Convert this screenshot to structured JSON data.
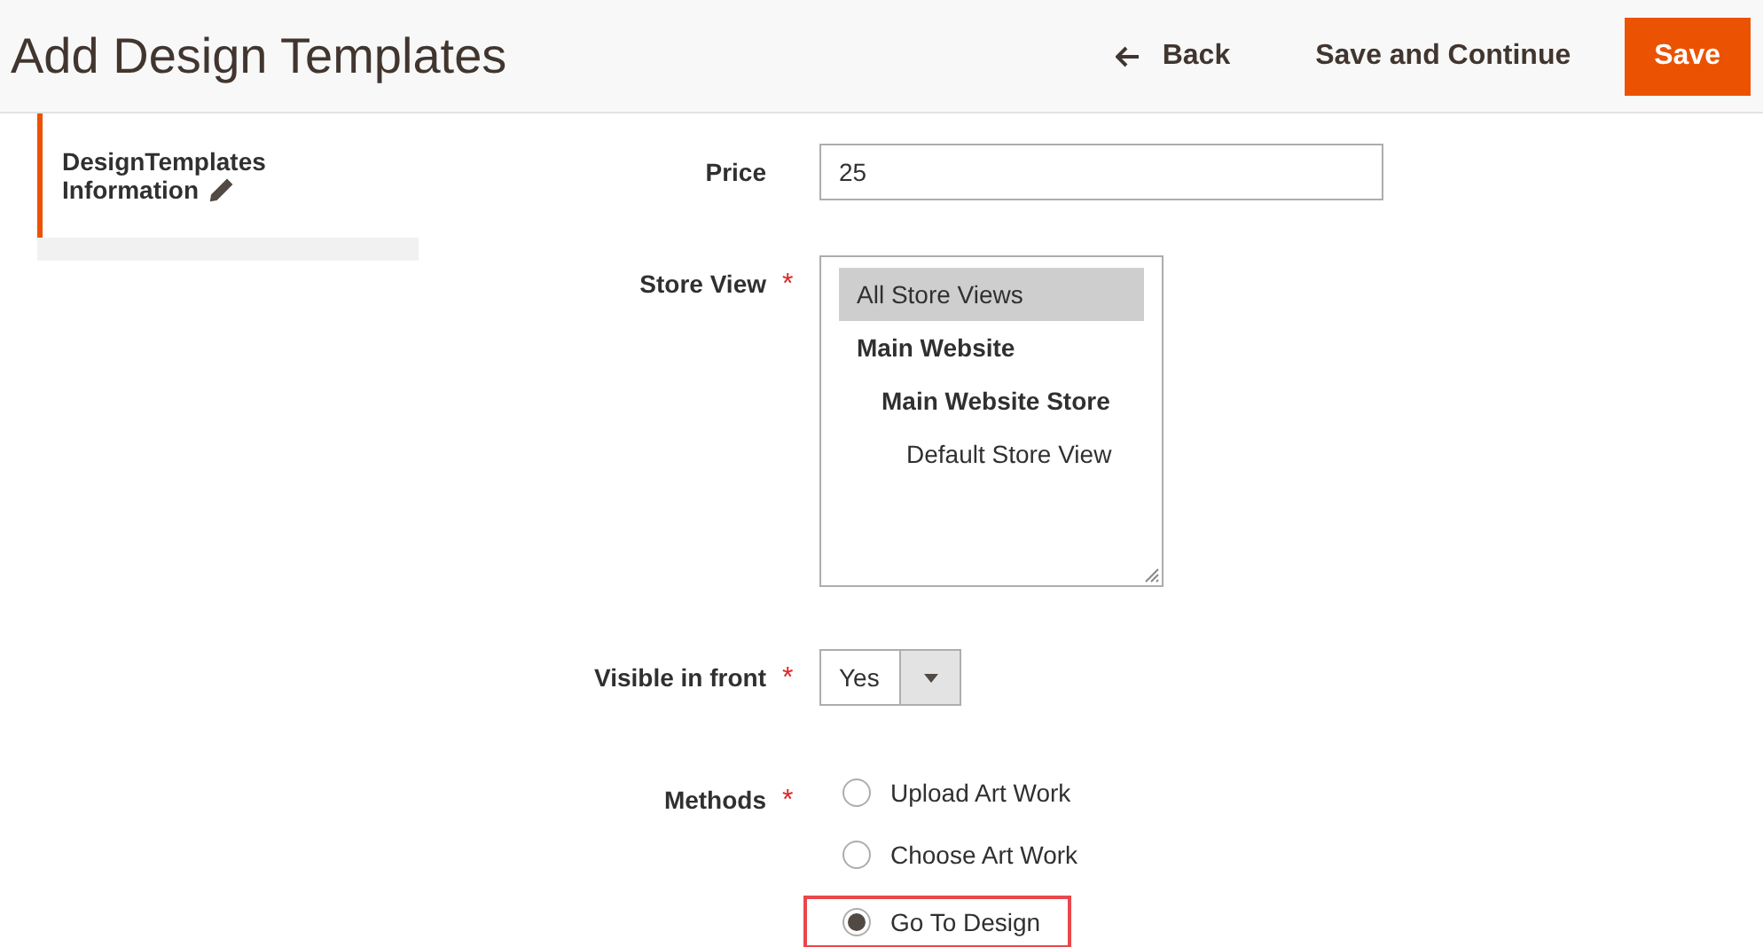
{
  "header": {
    "title": "Add Design Templates",
    "actions": [
      {
        "kind": "back",
        "label": "Back"
      },
      {
        "kind": "secondary",
        "label": "Save and Continue"
      },
      {
        "kind": "primary",
        "label": "Save"
      }
    ]
  },
  "sidebar": {
    "items": [
      {
        "label": "DesignTemplates Information",
        "selected": true,
        "edited": true
      }
    ]
  },
  "form": {
    "fields": [
      {
        "kind": "text",
        "label": "Price",
        "value": "25"
      },
      {
        "kind": "multiselect",
        "label": "Store View",
        "required_mark": "*",
        "options": [
          {
            "label": "All Store Views",
            "selected": true
          },
          {
            "label": "Main Website",
            "selected": false,
            "children": [
              {
                "label": "Main Website Store",
                "selected": false,
                "children": [
                  {
                    "label": "Default Store View",
                    "selected": false
                  }
                ]
              }
            ]
          }
        ]
      },
      {
        "kind": "select",
        "label": "Visible in front",
        "required_mark": "*",
        "value": "Yes"
      },
      {
        "kind": "radios",
        "label": "Methods",
        "required_mark": "*",
        "options": [
          {
            "label": "Upload Art Work",
            "selected": false,
            "highlighted": false
          },
          {
            "label": "Choose Art Work",
            "selected": false,
            "highlighted": false
          },
          {
            "label": "Go To Design",
            "selected": true,
            "highlighted": true
          }
        ]
      }
    ]
  }
}
